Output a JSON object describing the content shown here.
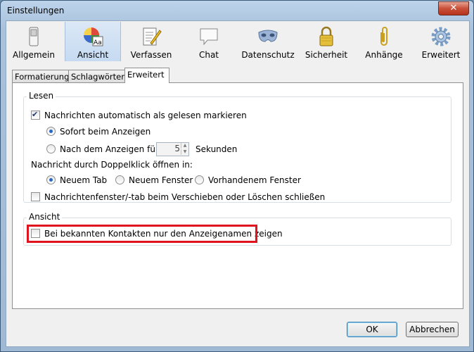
{
  "window": {
    "title": "Einstellungen",
    "close_glyph": "✕"
  },
  "toolbar": {
    "panes": [
      {
        "label": "Allgemein",
        "icon": "switch-icon"
      },
      {
        "label": "Ansicht",
        "icon": "palette-icon",
        "selected": true
      },
      {
        "label": "Verfassen",
        "icon": "compose-icon"
      },
      {
        "label": "Chat",
        "icon": "chat-icon"
      },
      {
        "label": "Datenschutz",
        "icon": "mask-icon"
      },
      {
        "label": "Sicherheit",
        "icon": "lock-icon"
      },
      {
        "label": "Anhänge",
        "icon": "paperclip-icon"
      },
      {
        "label": "Erweitert",
        "icon": "gear-icon"
      }
    ]
  },
  "tabs": [
    {
      "label": "Formatierung"
    },
    {
      "label": "Schlagwörter"
    },
    {
      "label": "Erweitert",
      "selected": true
    }
  ],
  "lesen": {
    "title": "Lesen",
    "mark_read_label": "Nachrichten automatisch als gelesen markieren",
    "mark_read_checked": true,
    "immediately_label": "Sofort beim Anzeigen",
    "after_label": "Nach dem Anzeigen für",
    "after_value": "5",
    "seconds_label": "Sekunden",
    "doubleclick_label": "Nachricht durch Doppelklick öffnen in:",
    "new_tab_label": "Neuem Tab",
    "new_window_label": "Neuem Fenster",
    "existing_window_label": "Vorhandenem Fenster",
    "close_label": "Nachrichtenfenster/-tab beim Verschieben oder Löschen schließen",
    "close_checked": false
  },
  "ansicht": {
    "title": "Ansicht",
    "display_names_label": "Bei bekannten Kontakten nur den Anzeigenamen zeigen",
    "display_names_checked": false
  },
  "buttons": {
    "ok": "OK",
    "cancel": "Abbrechen"
  },
  "colors": {
    "highlight": "#e0141f",
    "radio_dot": "#2a66c4"
  }
}
